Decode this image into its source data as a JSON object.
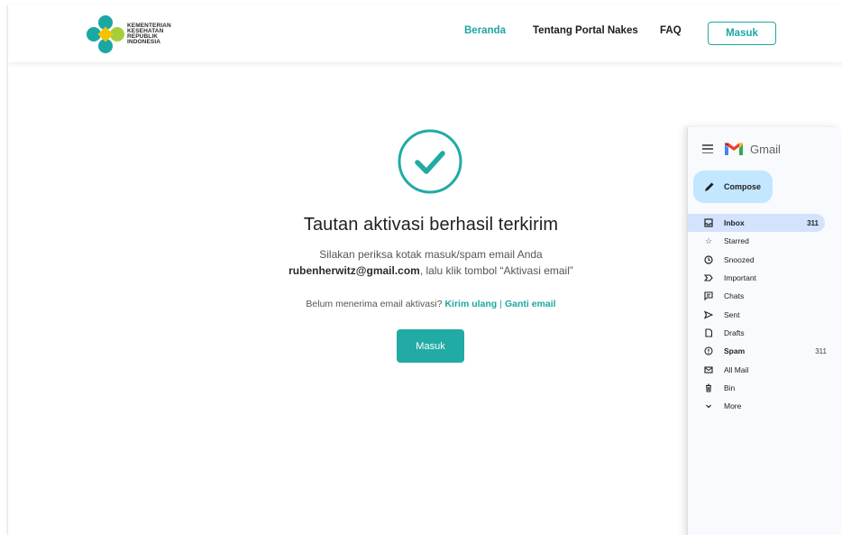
{
  "header": {
    "logo_lines": [
      "KEMENTERIAN",
      "KESEHATAN",
      "REPUBLIK",
      "INDONESIA"
    ],
    "nav": [
      "Beranda",
      "Tentang Portal Nakes",
      "FAQ"
    ],
    "login_button": "Masuk"
  },
  "main": {
    "title": "Tautan aktivasi berhasil terkirim",
    "message_line1": "Silakan periksa kotak masuk/spam email Anda",
    "email": "rubenherwitz@gmail.com",
    "message_line2_suffix": ", lalu klik tombol “Aktivasi email”",
    "resend_prompt": "Belum menerima email aktivasi?",
    "resend_link": "Kirim ulang",
    "separator": "|",
    "change_email_link": "Ganti email",
    "login_button": "Masuk"
  },
  "gmail": {
    "title": "Gmail",
    "compose": "Compose",
    "items": [
      {
        "label": "Inbox",
        "count": "311",
        "icon": "inbox-icon"
      },
      {
        "label": "Starred",
        "count": "",
        "icon": "star-icon"
      },
      {
        "label": "Snoozed",
        "count": "",
        "icon": "clock-icon"
      },
      {
        "label": "Important",
        "count": "",
        "icon": "important-icon"
      },
      {
        "label": "Chats",
        "count": "",
        "icon": "chat-icon"
      },
      {
        "label": "Sent",
        "count": "",
        "icon": "send-icon"
      },
      {
        "label": "Drafts",
        "count": "",
        "icon": "draft-icon"
      },
      {
        "label": "Spam",
        "count": "311",
        "icon": "spam-icon"
      },
      {
        "label": "All Mail",
        "count": "",
        "icon": "mail-icon"
      },
      {
        "label": "Bin",
        "count": "",
        "icon": "trash-icon"
      },
      {
        "label": "More",
        "count": "",
        "icon": "chevron-down-icon"
      }
    ]
  },
  "colors": {
    "accent": "#22aaa5",
    "gmail_selected": "#d3e3fd",
    "compose_bg": "#c2e7ff"
  }
}
